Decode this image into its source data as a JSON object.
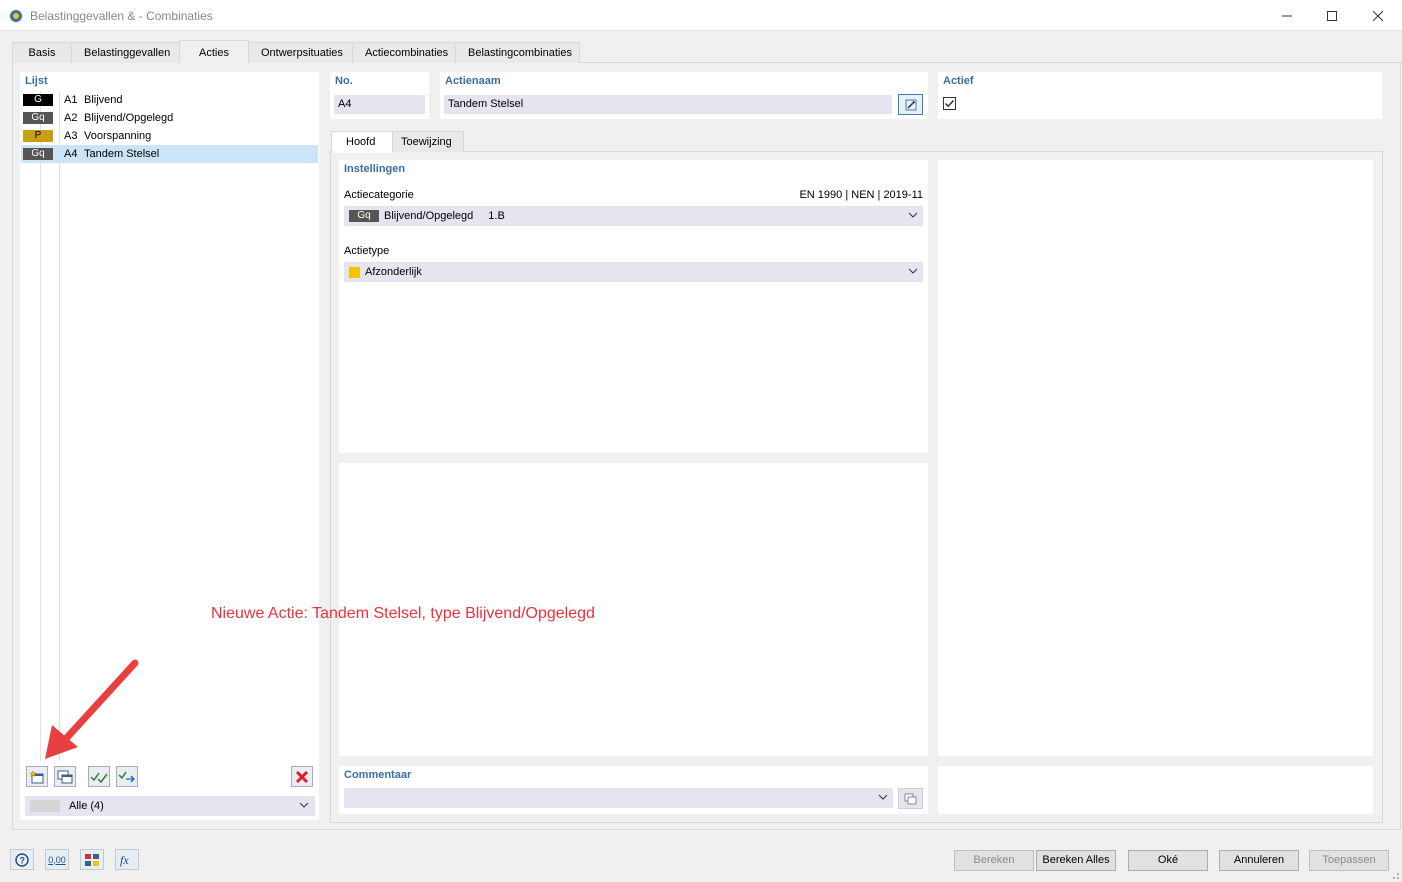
{
  "window": {
    "title": "Belastinggevallen & - Combinaties"
  },
  "main_tabs": [
    {
      "label": "Basis"
    },
    {
      "label": "Belastinggevallen"
    },
    {
      "label": "Acties"
    },
    {
      "label": "Ontwerpsituaties"
    },
    {
      "label": "Actiecombinaties"
    },
    {
      "label": "Belastingcombinaties"
    }
  ],
  "list": {
    "header": "Lijst",
    "items": [
      {
        "badge": "G",
        "badge_color": "#000000",
        "no": "A1",
        "name": "Blijvend"
      },
      {
        "badge": "Gq",
        "badge_color": "#555555",
        "no": "A2",
        "name": "Blijvend/Opgelegd"
      },
      {
        "badge": "P",
        "badge_color": "#c8a017",
        "no": "A3",
        "name": "Voorspanning"
      },
      {
        "badge": "Gq",
        "badge_color": "#555555",
        "no": "A4",
        "name": "Tandem Stelsel",
        "selected": true
      }
    ],
    "filter": "Alle (4)"
  },
  "fields": {
    "no_label": "No.",
    "no_value": "A4",
    "name_label": "Actienaam",
    "name_value": "Tandem Stelsel",
    "active_label": "Actief",
    "active_checked": true
  },
  "sub_tabs": [
    {
      "label": "Hoofd"
    },
    {
      "label": "Toewijzing"
    }
  ],
  "settings": {
    "header": "Instellingen",
    "category_label": "Actiecategorie",
    "norm": "EN 1990 | NEN | 2019-11",
    "category_badge": "Gq",
    "category_value": "Blijvend/Opgelegd",
    "category_code": "1.B",
    "type_label": "Actietype",
    "type_value": "Afzonderlijk",
    "type_color": "#f5c400"
  },
  "comment": {
    "label": "Commentaar"
  },
  "annotation": "Nieuwe Actie: Tandem Stelsel, type Blijvend/Opgelegd",
  "buttons": {
    "calculate": "Bereken",
    "calculate_all": "Bereken Alles",
    "ok": "Oké",
    "cancel": "Annuleren",
    "apply": "Toepassen"
  },
  "bottom_icons": {
    "number_icon_text": "0,00"
  }
}
